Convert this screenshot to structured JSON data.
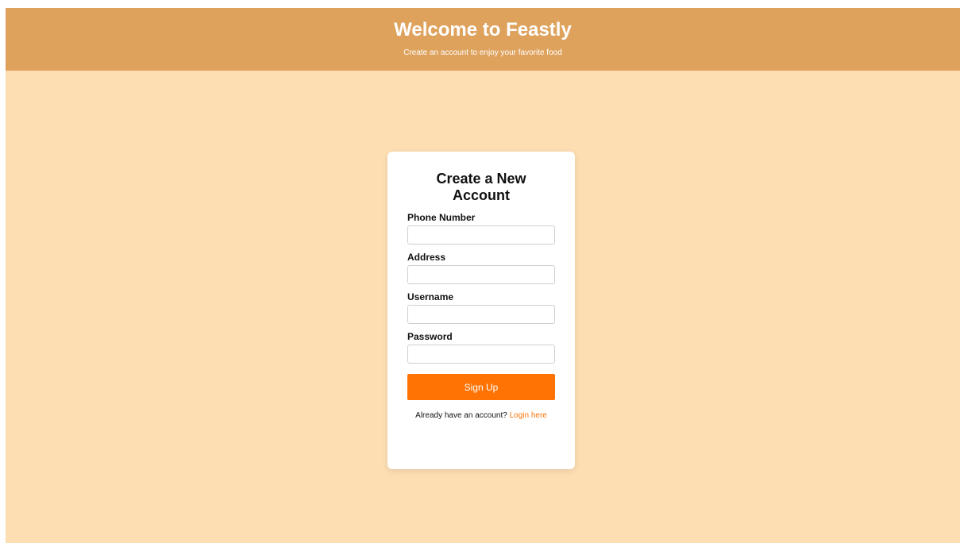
{
  "header": {
    "title": "Welcome to Feastly",
    "subtitle": "Create an account to enjoy your favorite food"
  },
  "form": {
    "title": "Create a New Account",
    "fields": [
      {
        "label": "Phone Number",
        "value": "",
        "placeholder": ""
      },
      {
        "label": "Address",
        "value": "",
        "placeholder": ""
      },
      {
        "label": "Username",
        "value": "",
        "placeholder": ""
      },
      {
        "label": "Password",
        "value": "",
        "placeholder": ""
      }
    ],
    "submit_label": "Sign Up",
    "login_prompt": "Already have an account?",
    "login_link": "Login here"
  },
  "colors": {
    "header_bg": "#dea25d",
    "page_bg": "#fddeb3",
    "accent": "#ff7305"
  }
}
